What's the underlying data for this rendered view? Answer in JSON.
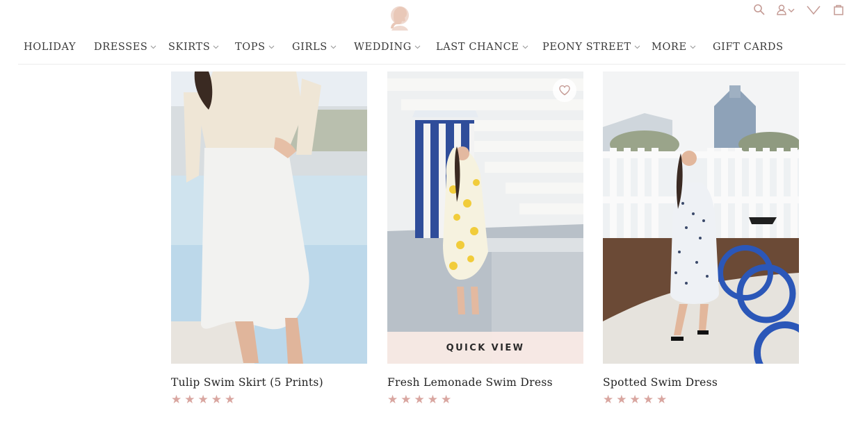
{
  "header": {
    "logo_icon": "silhouette-logo-icon",
    "utility_icons": [
      "search-icon",
      "account-icon",
      "wishlist-icon",
      "cart-icon"
    ],
    "accent_color": "#c49a94"
  },
  "nav": {
    "items": [
      {
        "label": "HOLIDAY",
        "has_dropdown": false
      },
      {
        "label": "DRESSES",
        "has_dropdown": true
      },
      {
        "label": "SKIRTS",
        "has_dropdown": true
      },
      {
        "label": "TOPS",
        "has_dropdown": true
      },
      {
        "label": "GIRLS",
        "has_dropdown": true
      },
      {
        "label": "WEDDING",
        "has_dropdown": true
      },
      {
        "label": "LAST CHANCE",
        "has_dropdown": true
      },
      {
        "label": "PEONY STREET",
        "has_dropdown": true
      },
      {
        "label": "MORE",
        "has_dropdown": true
      },
      {
        "label": "GIFT CARDS",
        "has_dropdown": false
      }
    ]
  },
  "products": [
    {
      "title": "Tulip Swim Skirt (5 Prints)",
      "rating": 5,
      "stars": "★★★★★"
    },
    {
      "title": "Fresh Lemonade Swim Dress",
      "rating": 5,
      "stars": "★★★★★",
      "quick_view_label": "QUICK VIEW",
      "wishlist_icon": "heart-icon"
    },
    {
      "title": "Spotted Swim Dress",
      "rating": 5,
      "stars": "★★★★★"
    }
  ],
  "colors": {
    "star": "#d9a6a0",
    "quick_view_bg": "#f8e9e4"
  }
}
